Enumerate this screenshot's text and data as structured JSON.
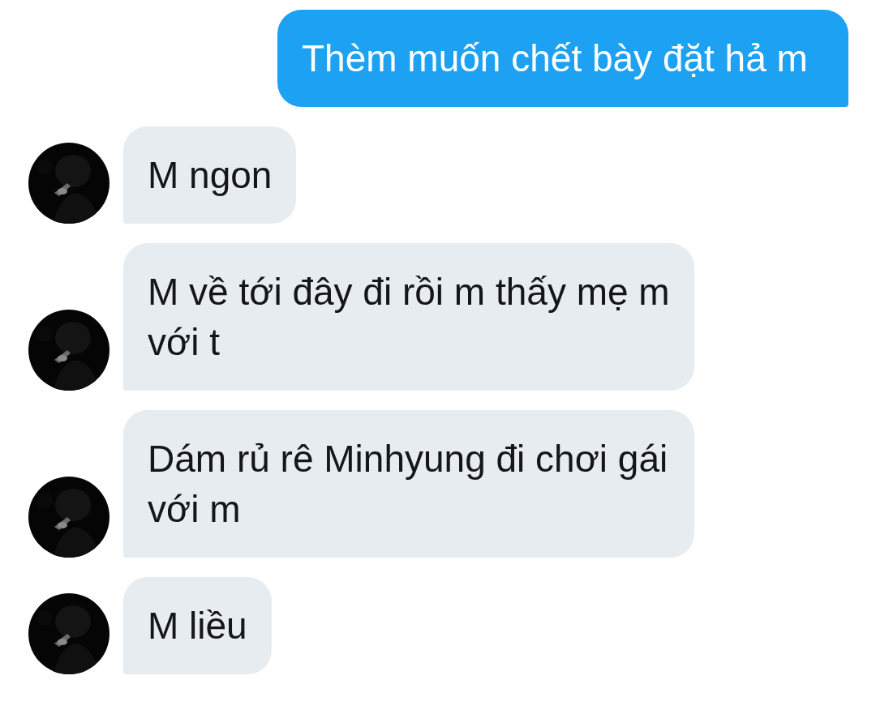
{
  "messages": [
    {
      "kind": "sent",
      "text": "Thèm muốn chết bày đặt hả m"
    },
    {
      "kind": "received",
      "text": "M ngon"
    },
    {
      "kind": "received",
      "text": "M về tới đây đi rồi m thấy mẹ m với t"
    },
    {
      "kind": "received",
      "text": "Dám rủ rê Minhyung đi chơi gái với m"
    },
    {
      "kind": "received",
      "text": "M liều"
    }
  ]
}
